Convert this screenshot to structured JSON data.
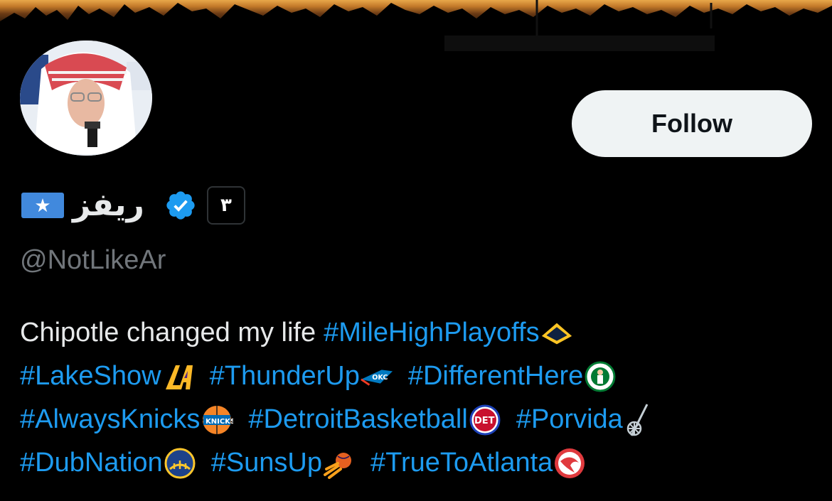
{
  "profile": {
    "display_name": "ريفز",
    "handle": "@NotLikeAr",
    "affiliate_badge_text": "٣",
    "follow_label": "Follow"
  },
  "bio": {
    "text": "Chipotle changed my life",
    "hashtags": [
      "#MileHighPlayoffs",
      "#LakeShow",
      "#ThunderUp",
      "#DifferentHere",
      "#AlwaysKnicks",
      "#DetroitBasketball",
      "#Porvida",
      "#DubNation",
      "#SunsUp",
      "#TrueToAtlanta"
    ],
    "team_icons": [
      "nuggets-mountain-icon",
      "lakers-logo-icon",
      "thunder-logo-icon",
      "celtics-logo-icon",
      "knicks-logo-icon",
      "pistons-logo-icon",
      "spurs-logo-icon",
      "warriors-logo-icon",
      "suns-logo-icon",
      "hawks-logo-icon"
    ]
  },
  "icons": {
    "flag": "somalia-flag-icon",
    "verified": "verified-badge-icon"
  },
  "colors": {
    "background": "#000000",
    "text_primary": "#e7e9ea",
    "text_secondary": "#71767b",
    "link": "#1d9bf0",
    "follow_bg": "#eff3f4",
    "verified": "#1d9bf0"
  }
}
